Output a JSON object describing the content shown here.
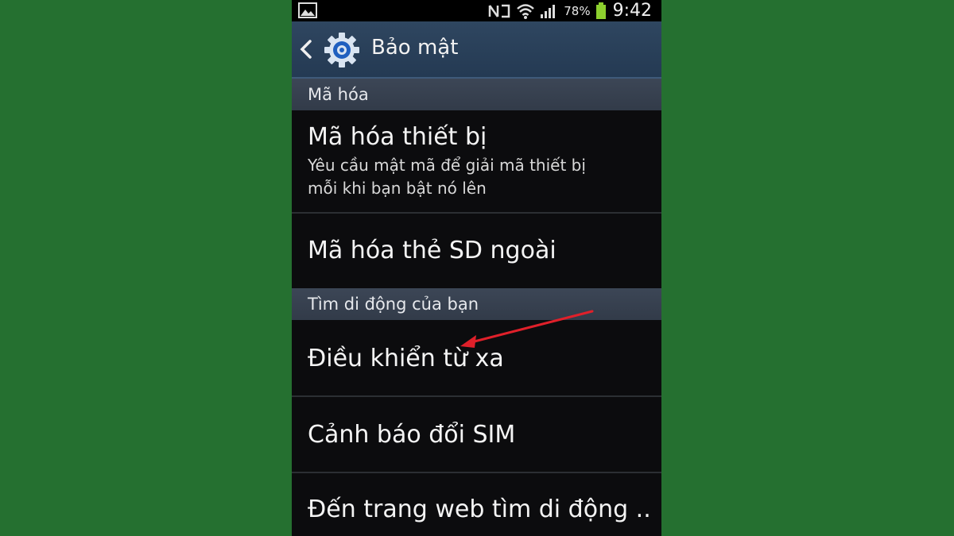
{
  "status_bar": {
    "battery_percent": "78%",
    "time": "9:42"
  },
  "action_bar": {
    "title": "Bảo mật"
  },
  "sections": {
    "encryption": {
      "header": "Mã hóa",
      "items": [
        {
          "title": "Mã hóa thiết bị",
          "subtitle_line1": "Yêu cầu mật mã để giải mã thiết bị",
          "subtitle_line2": "mỗi khi bạn bật nó lên"
        },
        {
          "title": "Mã hóa thẻ SD ngoài"
        }
      ]
    },
    "find_mobile": {
      "header": "Tìm di động của bạn",
      "items": [
        {
          "title": "Điều khiển từ xa"
        },
        {
          "title": "Cảnh báo đổi SIM"
        },
        {
          "title": "Đến trang web tìm di động .."
        }
      ]
    }
  },
  "colors": {
    "background": "#257030",
    "action_bar": "#2f4660",
    "section_header": "#3c4656",
    "list_background": "#0c0c0e",
    "annotation_arrow": "#e0202a"
  },
  "icons": {
    "status_left": "image-icon",
    "status_right": [
      "nfc-icon",
      "wifi-icon",
      "signal-icon",
      "battery-icon"
    ],
    "action_bar": [
      "back-icon",
      "gear-icon"
    ],
    "annotation": "red-arrow-icon"
  }
}
